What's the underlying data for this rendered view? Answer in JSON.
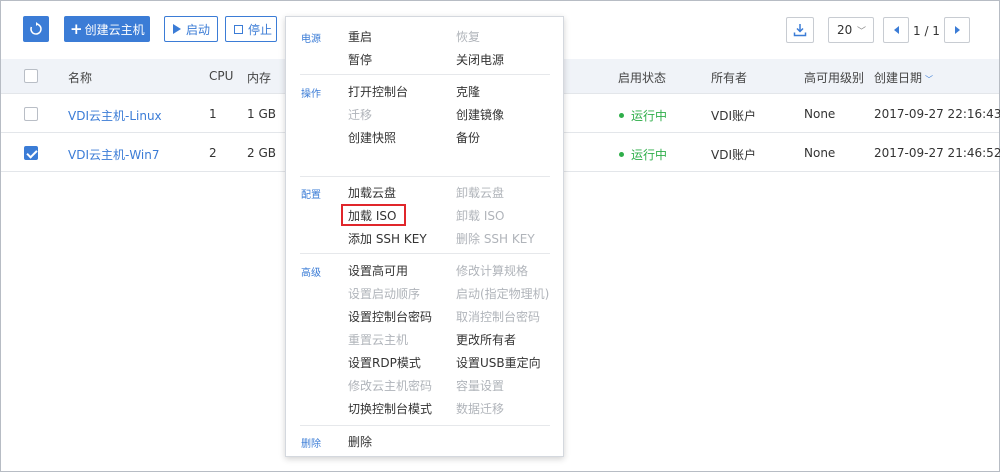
{
  "toolbar": {
    "create_label": "创建云主机",
    "start_label": "启动",
    "stop_label": "停止"
  },
  "pagination": {
    "page_size": "20",
    "page_text": "1 / 1"
  },
  "table": {
    "headers": {
      "name": "名称",
      "cpu": "CPU",
      "memory": "内存",
      "status": "启用状态",
      "owner": "所有者",
      "ha_level": "高可用级别",
      "created": "创建日期"
    },
    "rows": [
      {
        "checked": false,
        "name": "VDI云主机-Linux",
        "cpu": "1",
        "memory": "1 GB",
        "status": "运行中",
        "owner": "VDI账户",
        "ha_level": "None",
        "created": "2017-09-27 22:16:43"
      },
      {
        "checked": true,
        "name": "VDI云主机-Win7",
        "cpu": "2",
        "memory": "2 GB",
        "status": "运行中",
        "owner": "VDI账户",
        "ha_level": "None",
        "created": "2017-09-27 21:46:52"
      }
    ]
  },
  "menu": {
    "cat_power": "电源",
    "cat_ops": "操作",
    "cat_config": "配置",
    "cat_advanced": "高级",
    "cat_delete": "删除",
    "power": {
      "reboot": "重启",
      "resume": "恢复",
      "pause": "暂停",
      "power_off": "关闭电源"
    },
    "ops": {
      "open_console": "打开控制台",
      "clone": "克隆",
      "migrate": "迁移",
      "create_image": "创建镜像",
      "create_snapshot": "创建快照",
      "backup": "备份"
    },
    "config": {
      "attach_volume": "加载云盘",
      "detach_volume": "卸载云盘",
      "attach_iso": "加载 ISO",
      "detach_iso": "卸载 ISO",
      "add_ssh_key": "添加 SSH KEY",
      "delete_ssh_key": "删除 SSH KEY"
    },
    "advanced": {
      "set_ha": "设置高可用",
      "change_spec": "修改计算规格",
      "set_boot_order": "设置启动顺序",
      "start_on_host": "启动(指定物理机)",
      "set_console_pwd": "设置控制台密码",
      "cancel_console_pwd": "取消控制台密码",
      "reset_vm": "重置云主机",
      "change_owner": "更改所有者",
      "set_rdp": "设置RDP模式",
      "set_usb": "设置USB重定向",
      "change_vm_pwd": "修改云主机密码",
      "capacity": "容量设置",
      "switch_console": "切换控制台模式",
      "data_migrate": "数据迁移"
    },
    "delete": {
      "delete": "删除"
    }
  }
}
